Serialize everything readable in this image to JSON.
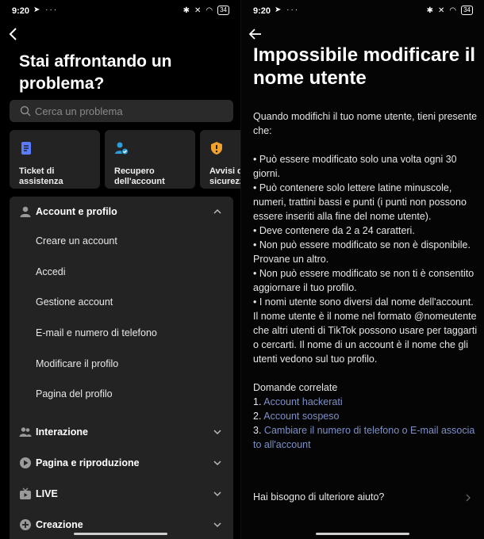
{
  "left_panel": {
    "status": {
      "time": "9:20",
      "battery": "34"
    },
    "title": "Stai affrontando un problema?",
    "search": {
      "placeholder": "Cerca un problema"
    },
    "cards": [
      {
        "label": "Ticket di assistenza",
        "icon": "ticket-icon",
        "color": "#5b7cff"
      },
      {
        "label": "Recupero dell'account",
        "icon": "account-recovery-icon",
        "color": "#2d9cdb"
      },
      {
        "label": "Avvisi di sicurezza",
        "icon": "security-shield-icon",
        "color": "#f2a22c"
      }
    ],
    "sections": [
      {
        "label": "Account e profilo",
        "icon": "user-icon",
        "expanded": true,
        "items": [
          "Creare un account",
          "Accedi",
          "Gestione account",
          "E-mail e numero di telefono",
          "Modificare il profilo",
          "Pagina del profilo"
        ]
      },
      {
        "label": "Interazione",
        "icon": "people-icon",
        "expanded": false
      },
      {
        "label": "Pagina e riproduzione",
        "icon": "play-icon",
        "expanded": false
      },
      {
        "label": "LIVE",
        "icon": "live-tv-icon",
        "expanded": false
      },
      {
        "label": "Creazione",
        "icon": "plus-icon",
        "expanded": false
      }
    ]
  },
  "right_panel": {
    "status": {
      "time": "9:20",
      "battery": "34"
    },
    "title": "Impossibile modificare il nome utente",
    "intro": "Quando modifichi il tuo nome utente, tieni presente che:",
    "bullets": [
      "• Può essere modificato solo una volta ogni 30 giorni.",
      "• Può contenere solo lettere latine minuscole, numeri, trattini bassi e punti (i punti non possono essere inseriti alla fine del nome utente).",
      "• Deve contenere da 2 a 24 caratteri.",
      "• Non può essere modificato se non è disponibile. Provane un altro.",
      "• Non può essere modificato se non ti è consentito aggiornare il tuo profilo.",
      "• I nomi utente sono diversi dal nome dell'account. Il nome utente è il nome nel formato @nomeutente che altri utenti di TikTok possono usare per taggarti o cercarti. Il nome di un account è il nome che gli utenti vedono sul tuo profilo."
    ],
    "related_title": "Domande correlate",
    "related": [
      {
        "num": "1.",
        "label": "Account hackerati"
      },
      {
        "num": "2.",
        "label": "Account sospeso"
      },
      {
        "num": "3.",
        "label": "Cambiare il numero di telefono o E-mail associa to all'account"
      }
    ],
    "help": "Hai bisogno di ulteriore aiuto?",
    "link_color": "#7d90c8"
  }
}
